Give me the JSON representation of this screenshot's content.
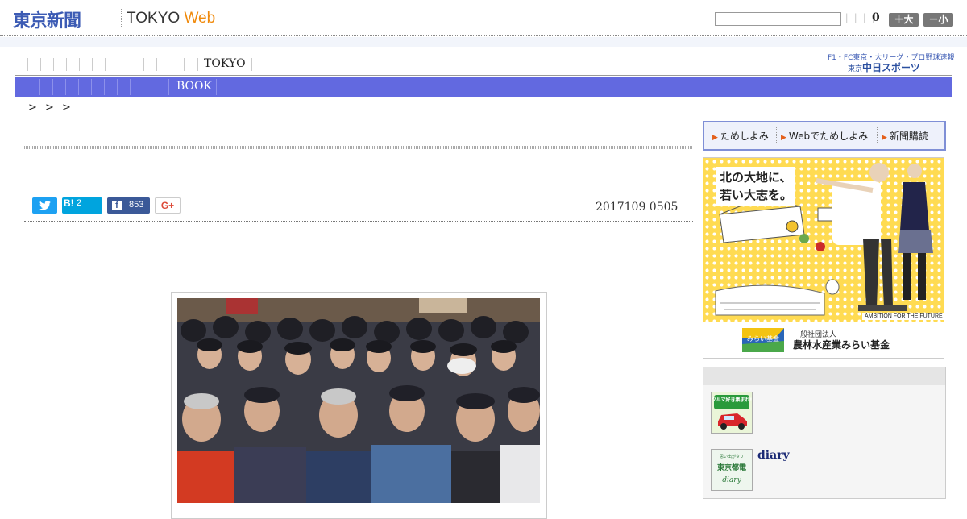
{
  "header": {
    "logo_jp": "東京新聞",
    "logo_tokyo": "TOKYO",
    "logo_web": "Web",
    "search_placeholder": "",
    "separators": "| | | |",
    "count": "0",
    "font_plus": "＋大",
    "font_minus": "－小"
  },
  "nav_primary": {
    "active_label": "TOKYO",
    "promo_line": "F1・FC東京・大リーグ・プロ野球速報",
    "promo_logo_small": "東京",
    "promo_logo": "中日スポーツ"
  },
  "nav_secondary": {
    "active_label": "BOOK"
  },
  "breadcrumb": "> > >",
  "share": {
    "twitter_icon": "twitter-bird-icon",
    "hatena_label": "B!",
    "hatena_count": "2",
    "facebook_icon": "f",
    "facebook_count": "853",
    "gplus_label": "G+"
  },
  "article": {
    "date": "2017109 0505"
  },
  "sidebar": {
    "trial_links": [
      "ためしよみ",
      "Webでためしよみ",
      "新聞購読"
    ],
    "ad": {
      "headline_line1": "北の大地に、",
      "headline_line2": "若い大志を。",
      "ambition": "AMBITION FOR THE FUTURE",
      "org_small": "一般社団法人",
      "org": "農林水産業みらい基金",
      "badge": "みらい基金"
    },
    "list": [
      {
        "thumb_text": "クルマ好き集まれ!",
        "label": ""
      },
      {
        "thumb_text_top": "思い出がタリ",
        "thumb_text_mid": "東京都電",
        "thumb_text_bottom": "diary",
        "label": "diary"
      }
    ]
  },
  "colors": {
    "brand_blue": "#3c5bb4",
    "nav_bar": "#6269e0",
    "web_orange": "#f08a0c",
    "ad_yellow": "#ffdb52"
  }
}
